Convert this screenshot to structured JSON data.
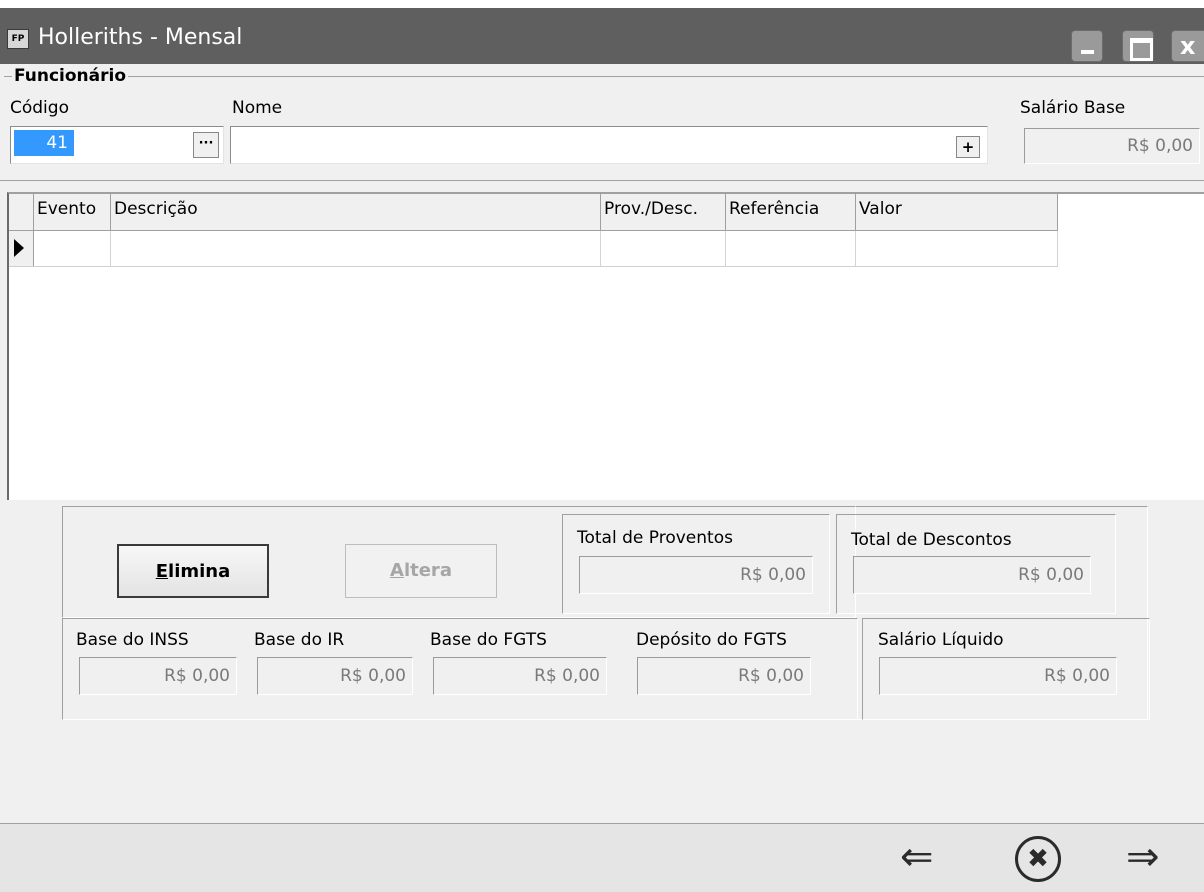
{
  "window": {
    "title": "Holleriths - Mensal",
    "app_icon_text": "FP",
    "close_glyph": "x"
  },
  "funcionario": {
    "group_title": "Funcionário",
    "codigo_label": "Código",
    "codigo_value": "41",
    "codigo_lookup_label": "···",
    "nome_label": "Nome",
    "nome_value": "",
    "nome_add_label": "+",
    "salario_base_label": "Salário Base",
    "salario_base_value": "R$ 0,00"
  },
  "grid": {
    "columns": [
      "Evento",
      "Descrição",
      "Prov./Desc.",
      "Referência",
      "Valor"
    ],
    "rows": [
      [
        "",
        "",
        "",
        "",
        ""
      ]
    ]
  },
  "buttons": {
    "elimina_hotkey": "E",
    "elimina_rest": "limina",
    "altera_hotkey": "A",
    "altera_rest": "ltera"
  },
  "totals": {
    "proventos_label": "Total de Proventos",
    "proventos_value": "R$ 0,00",
    "descontos_label": "Total de Descontos",
    "descontos_value": "R$ 0,00",
    "inss_label": "Base do INSS",
    "inss_value": "R$ 0,00",
    "ir_label": "Base do IR",
    "ir_value": "R$ 0,00",
    "fgts_label": "Base do FGTS",
    "fgts_value": "R$ 0,00",
    "deposito_label": "Depósito do FGTS",
    "deposito_value": "R$ 0,00",
    "liquido_label": "Salário Líquido",
    "liquido_value": "R$ 0,00"
  },
  "footer": {
    "prev_icon": "⇐",
    "close_icon": "✖",
    "next_icon": "⇒"
  }
}
